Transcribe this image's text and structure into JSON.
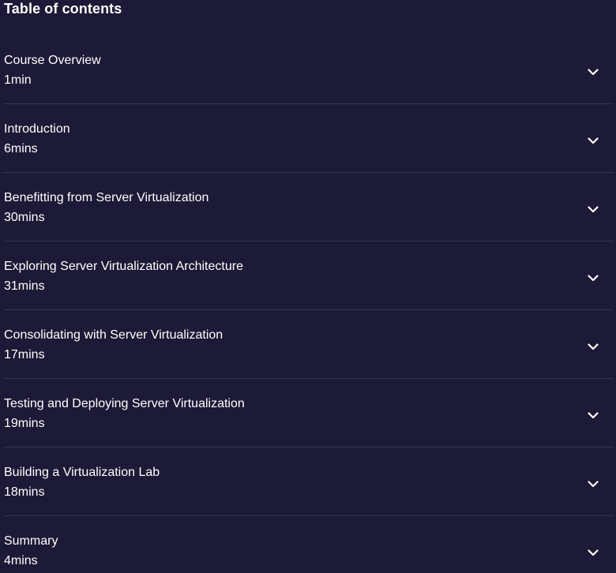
{
  "toc": {
    "title": "Table of contents",
    "items": [
      {
        "title": "Course Overview",
        "duration": "1min"
      },
      {
        "title": "Introduction",
        "duration": "6mins"
      },
      {
        "title": "Benefitting from Server Virtualization",
        "duration": "30mins"
      },
      {
        "title": "Exploring Server Virtualization Architecture",
        "duration": "31mins"
      },
      {
        "title": "Consolidating with Server Virtualization",
        "duration": "17mins"
      },
      {
        "title": "Testing and Deploying Server Virtualization",
        "duration": "19mins"
      },
      {
        "title": "Building a Virtualization Lab",
        "duration": "18mins"
      },
      {
        "title": "Summary",
        "duration": "4mins"
      }
    ],
    "expand_icon": "chevron-down-icon"
  },
  "colors": {
    "background": "#1c1a36",
    "divider": "#36345a",
    "text": "#ffffff"
  }
}
